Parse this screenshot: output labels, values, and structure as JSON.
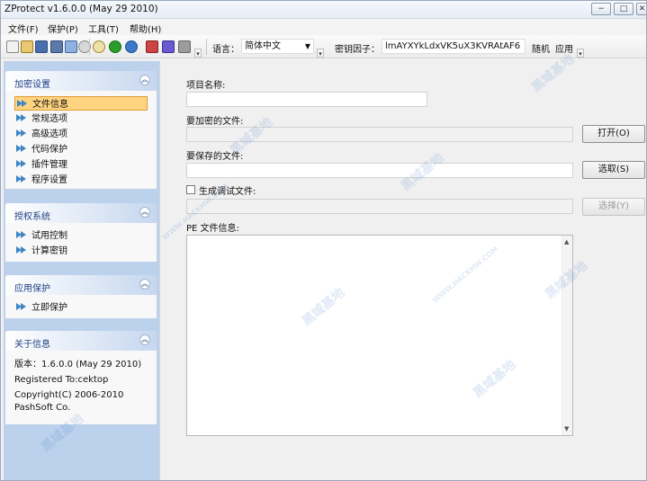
{
  "window": {
    "title": "ZProtect v1.6.0.0 (May 29 2010)"
  },
  "menu": [
    "文件(F)",
    "保护(P)",
    "工具(T)",
    "帮助(H)"
  ],
  "toolbar": {
    "language_label": "语言：",
    "language_value": "简体中文",
    "key_label": "密钥因子：",
    "key_value": "lmAYXYkLdxVK5uX3KVRAtAF6",
    "random_label": "随机",
    "apply_label": "应用"
  },
  "sidebar": {
    "encrypt": {
      "title": "加密设置",
      "items": [
        "文件信息",
        "常规选项",
        "高级选项",
        "代码保护",
        "插件管理",
        "程序设置"
      ]
    },
    "license": {
      "title": "授权系统",
      "items": [
        "试用控制",
        "计算密钥"
      ]
    },
    "app": {
      "title": "应用保护",
      "items": [
        "立即保护"
      ]
    },
    "about": {
      "title": "关于信息",
      "lines": [
        "版本：1.6.0.0 (May 29 2010)",
        "Registered To:cektop",
        "Copyright(C) 2006-2010",
        "PashSoft Co."
      ]
    }
  },
  "form": {
    "project_label": "项目名称:",
    "project_value": "",
    "encrypt_file_label": "要加密的文件:",
    "encrypt_file_value": "",
    "open_button": "打开(O)",
    "save_file_label": "要保存的文件:",
    "save_file_value": "",
    "select_button": "选取(S)",
    "debug_label": "生成调试文件:",
    "debug_checked": false,
    "debug_value": "",
    "choose_button": "选择(Y)",
    "pe_label": "PE 文件信息:",
    "pe_value": ""
  },
  "watermark": "黑域基地",
  "watermark_url": "WWW.HACKHW.COM",
  "colors": {
    "sidebar_bg": "#bcd1ec",
    "panel_title": "#1e3f83",
    "selection": "#ffd480",
    "arrow": "#3f86c4"
  }
}
